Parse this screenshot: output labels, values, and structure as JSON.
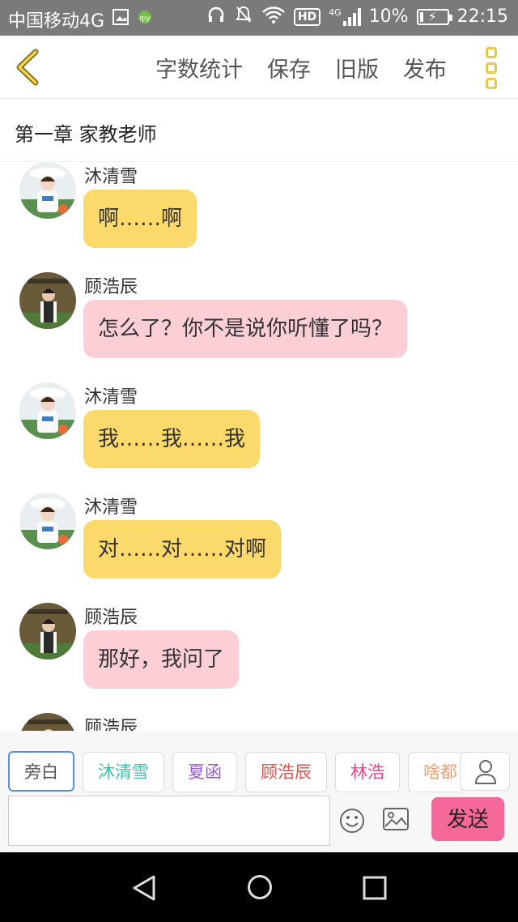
{
  "status_bar": {
    "carrier": "中国移动4G",
    "network_label": "4G",
    "hd_label": "HD",
    "battery": "10%",
    "time": "22:15"
  },
  "toolbar": {
    "back_icon": "chevron-left-icon",
    "items": [
      "字数统计",
      "保存",
      "旧版",
      "发布"
    ],
    "more_icon": "more-vertical-icon",
    "accent_color": "#e8c84a"
  },
  "chapter": {
    "title": "第一章 家教老师"
  },
  "messages": [
    {
      "name": "沐清雪",
      "text": "啊……啊",
      "bubble_color": "yellow",
      "avatar": "girl-avatar"
    },
    {
      "name": "顾浩辰",
      "text": "怎么了？你不是说你听懂了吗？",
      "bubble_color": "pink",
      "avatar": "boy-avatar"
    },
    {
      "name": "沐清雪",
      "text": "我……我……我",
      "bubble_color": "yellow",
      "avatar": "girl-avatar"
    },
    {
      "name": "沐清雪",
      "text": "对……对……对啊",
      "bubble_color": "yellow",
      "avatar": "girl-avatar"
    },
    {
      "name": "顾浩辰",
      "text": "那好，我问了",
      "bubble_color": "pink",
      "avatar": "boy-avatar"
    },
    {
      "name": "顾浩辰",
      "text": "",
      "bubble_color": "pink",
      "avatar": "boy-avatar"
    }
  ],
  "characters": [
    {
      "label": "旁白",
      "color": "#555555",
      "selected": true
    },
    {
      "label": "沐清雪",
      "color": "#3cbfae"
    },
    {
      "label": "夏函",
      "color": "#9b59d0"
    },
    {
      "label": "顾浩辰",
      "color": "#e0534a"
    },
    {
      "label": "林浩",
      "color": "#e8458a"
    },
    {
      "label": "啥都",
      "color": "#f0a070"
    }
  ],
  "input": {
    "value": "",
    "placeholder": "",
    "send_label": "发送",
    "send_color": "#f7689a"
  },
  "colors": {
    "yellow_bubble": "#fcd96b",
    "pink_bubble": "#fccfd6"
  }
}
